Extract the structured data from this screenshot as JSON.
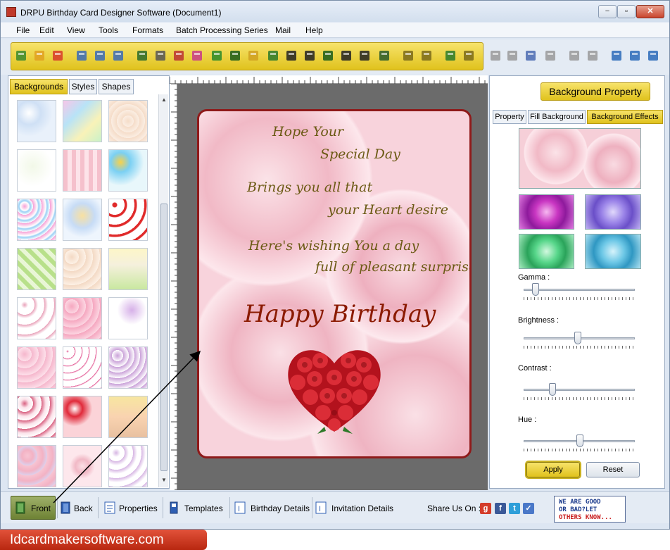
{
  "window": {
    "title": "DRPU Birthday Card Designer Software (Document1)",
    "controls": [
      "−",
      "▫",
      "✕"
    ]
  },
  "menu": {
    "items": [
      "File",
      "Edit",
      "View",
      "Tools",
      "Formats",
      "Batch Processing Series",
      "Mail",
      "Help"
    ]
  },
  "toolbar": {
    "buttons": [
      "new",
      "open",
      "close",
      "save",
      "save-as",
      "export",
      "properties",
      "print",
      "print-preview",
      "gift",
      "image-insert",
      "pen",
      "color-fill",
      "text-art",
      "barcode",
      "barcode2",
      "text",
      "text-frame",
      "signature",
      "line",
      "database",
      "database2",
      "undo",
      "redo",
      "cut",
      "copy",
      "paste",
      "delete",
      "bring-front",
      "send-back",
      "grid",
      "actual-size",
      "fit"
    ]
  },
  "left_panel": {
    "tabs": [
      "Backgrounds",
      "Styles",
      "Shapes"
    ],
    "active_tab": "Backgrounds",
    "thumbnail_count": 24
  },
  "card": {
    "lines": [
      "Hope Your",
      "Special Day",
      "Brings you all that",
      "your Heart desire",
      "Here's wishing You a day",
      "full of pleasant surprises",
      "Happy Birthday"
    ]
  },
  "right_panel": {
    "title": "Background Property",
    "tabs": [
      "Property",
      "Fill Background",
      "Background Effects"
    ],
    "active_tab": "Background Effects",
    "sliders": [
      {
        "label": "Gamma :",
        "value": 0.08
      },
      {
        "label": "Brightness :",
        "value": 0.48
      },
      {
        "label": "Contrast :",
        "value": 0.24
      },
      {
        "label": "Hue :",
        "value": 0.5
      }
    ],
    "apply_label": "Apply",
    "reset_label": "Reset"
  },
  "bottom_bar": {
    "front_label": "Front",
    "back_label": "Back",
    "properties_label": "Properties",
    "templates_label": "Templates",
    "birthday_details_label": "Birthday Details",
    "invitation_details_label": "Invitation Details",
    "share_label": "Share Us On :",
    "ad_lines": [
      "WE ARE GOOD",
      "OR BAD?LET",
      "OTHERS KNOW..."
    ]
  },
  "footer": {
    "site": "Idcardmakersoftware.com"
  },
  "colors": {
    "highlight": "#e8c828",
    "card_border": "#8f1a1a",
    "footer_bg": "#c93a1f"
  }
}
